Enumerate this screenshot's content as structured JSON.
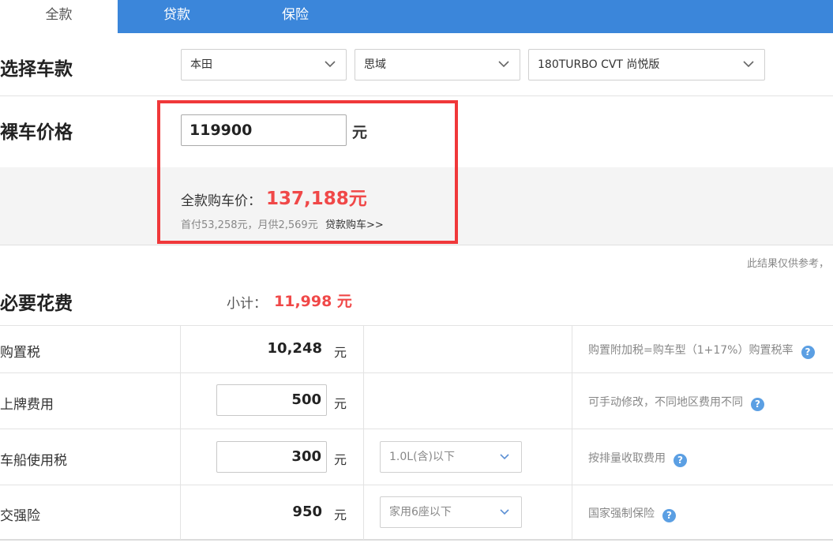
{
  "tabs": [
    {
      "label": "全款",
      "active": true
    },
    {
      "label": "贷款",
      "active": false
    },
    {
      "label": "保险",
      "active": false
    }
  ],
  "select_model": {
    "title": "选择车款",
    "brand": "本田",
    "series": "思域",
    "trim": "180TURBO CVT 尚悦版"
  },
  "bare_price": {
    "title": "裸车价格",
    "value": "119900",
    "unit": "元"
  },
  "total": {
    "label": "全款购车价：",
    "value": "137,188元",
    "summary": "首付53,258元，月供2,569元",
    "loan_link": "贷款购车>>"
  },
  "disclaimer": "此结果仅供参考，",
  "required_fees": {
    "title": "必要花费",
    "subtotal_label": "小计：",
    "subtotal_value": "11,998 元",
    "rows": [
      {
        "label": "购置税",
        "amount": "10,248",
        "unit": "元",
        "note": "购置附加税=购车型（1+17%）购置税率"
      },
      {
        "label": "上牌费用",
        "amount": "500",
        "unit": "元",
        "note": "可手动修改，不同地区费用不同"
      },
      {
        "label": "车船使用税",
        "amount": "300",
        "unit": "元",
        "option": "1.0L(含)以下",
        "note": "按排量收取费用"
      },
      {
        "label": "交强险",
        "amount": "950",
        "unit": "元",
        "option": "家用6座以下",
        "note": "国家强制保险"
      }
    ]
  },
  "icons": {
    "help": "question-circle-icon",
    "dropdown": "chevron-down-icon"
  },
  "colors": {
    "tab_bar": "#3b86da",
    "price_red": "#f04848",
    "highlight_border": "#f0383a",
    "help_blue": "#5b9fe3"
  }
}
